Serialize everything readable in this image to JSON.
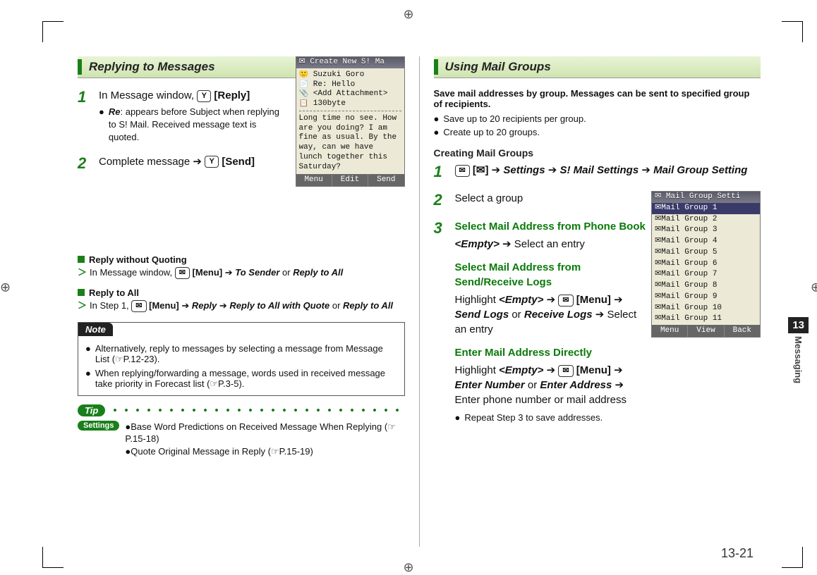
{
  "left": {
    "heading": "Replying to Messages",
    "step1": {
      "num": "1",
      "pre": "In Message window, ",
      "btn": "[Reply]",
      "bullet_label": "Re",
      "bullet_rest": ": appears before Subject when replying to S! Mail. Received message text is quoted."
    },
    "step2": {
      "num": "2",
      "pre": "Complete message ",
      "btn": "[Send]"
    },
    "sub1": {
      "title": "Reply without Quoting",
      "pre": "In Message window, ",
      "menu": "[Menu]",
      "a": "To Sender",
      "or": " or ",
      "b": "Reply to All"
    },
    "sub2": {
      "title": "Reply to All",
      "pre": "In Step 1, ",
      "menu": "[Menu]",
      "a": "Reply",
      "b": "Reply to All with Quote",
      "or": " or ",
      "c": "Reply to All"
    },
    "note_title": "Note",
    "note_items": [
      "Alternatively, reply to messages by selecting a message from Message List (☞P.12-23).",
      "When replying/forwarding a message, words used in received message take priority in Forecast list (☞P.3-5)."
    ],
    "tip_label": "Tip",
    "settings_label": "Settings",
    "settings_items": [
      "Base Word Predictions on Received Message When Replying (☞P.15-18)",
      "Quote Original Message in Reply (☞P.15-19)"
    ],
    "shot": {
      "title": "✉ Create New S! Ma",
      "rows": [
        "🙂 Suzuki Goro",
        "📄 Re: Hello",
        "📎 <Add Attachment>",
        "📋 130byte"
      ],
      "msg": "Long time no see. How are you doing?\nI am fine as usual.\nBy the way, can we have lunch together this Saturday?",
      "softkeys": [
        "Menu",
        "Edit",
        "Send"
      ]
    }
  },
  "right": {
    "heading": "Using Mail Groups",
    "intro": "Save mail addresses by group. Messages can be sent to specified group of recipients.",
    "bullets": [
      "Save up to 20 recipients per group.",
      "Create up to 20 groups."
    ],
    "sub_title": "Creating Mail Groups",
    "step1": {
      "num": "1",
      "icon_label": "[✉]",
      "path_a": "Settings",
      "path_b": "S! Mail Settings",
      "path_c": "Mail Group Setting"
    },
    "step2": {
      "num": "2",
      "text": "Select a group"
    },
    "step3": {
      "num": "3",
      "pb_title": "Select Mail Address from Phone Book",
      "pb_a": "<Empty>",
      "pb_b": "Select an entry",
      "log_title": "Select Mail Address from Send/Receive Logs",
      "log_pre": "Highlight ",
      "log_a": "<Empty>",
      "log_menu": "[Menu]",
      "log_b": "Send Logs",
      "log_or": " or ",
      "log_c": "Receive Logs",
      "log_d": "Select an entry",
      "dir_title": "Enter Mail Address Directly",
      "dir_pre": "Highlight ",
      "dir_a": "<Empty>",
      "dir_menu": "[Menu]",
      "dir_b": "Enter Number",
      "dir_or": " or ",
      "dir_c": "Enter Address",
      "dir_d": "Enter phone number or mail address",
      "repeat": "Repeat Step 3 to save addresses."
    },
    "shot": {
      "title": "✉ Mail Group Setti",
      "rows": [
        "✉Mail Group 1",
        "✉Mail Group 2",
        "✉Mail Group 3",
        "✉Mail Group 4",
        "✉Mail Group 5",
        "✉Mail Group 6",
        "✉Mail Group 7",
        "✉Mail Group 8",
        "✉Mail Group 9",
        "✉Mail Group 10",
        "✉Mail Group 11"
      ],
      "softkeys": [
        "Menu",
        "View",
        "Back"
      ]
    }
  },
  "side": {
    "num": "13",
    "label": "Messaging"
  },
  "page_num": "13-21",
  "keys": {
    "Y": "Y",
    "mail": "✉"
  }
}
